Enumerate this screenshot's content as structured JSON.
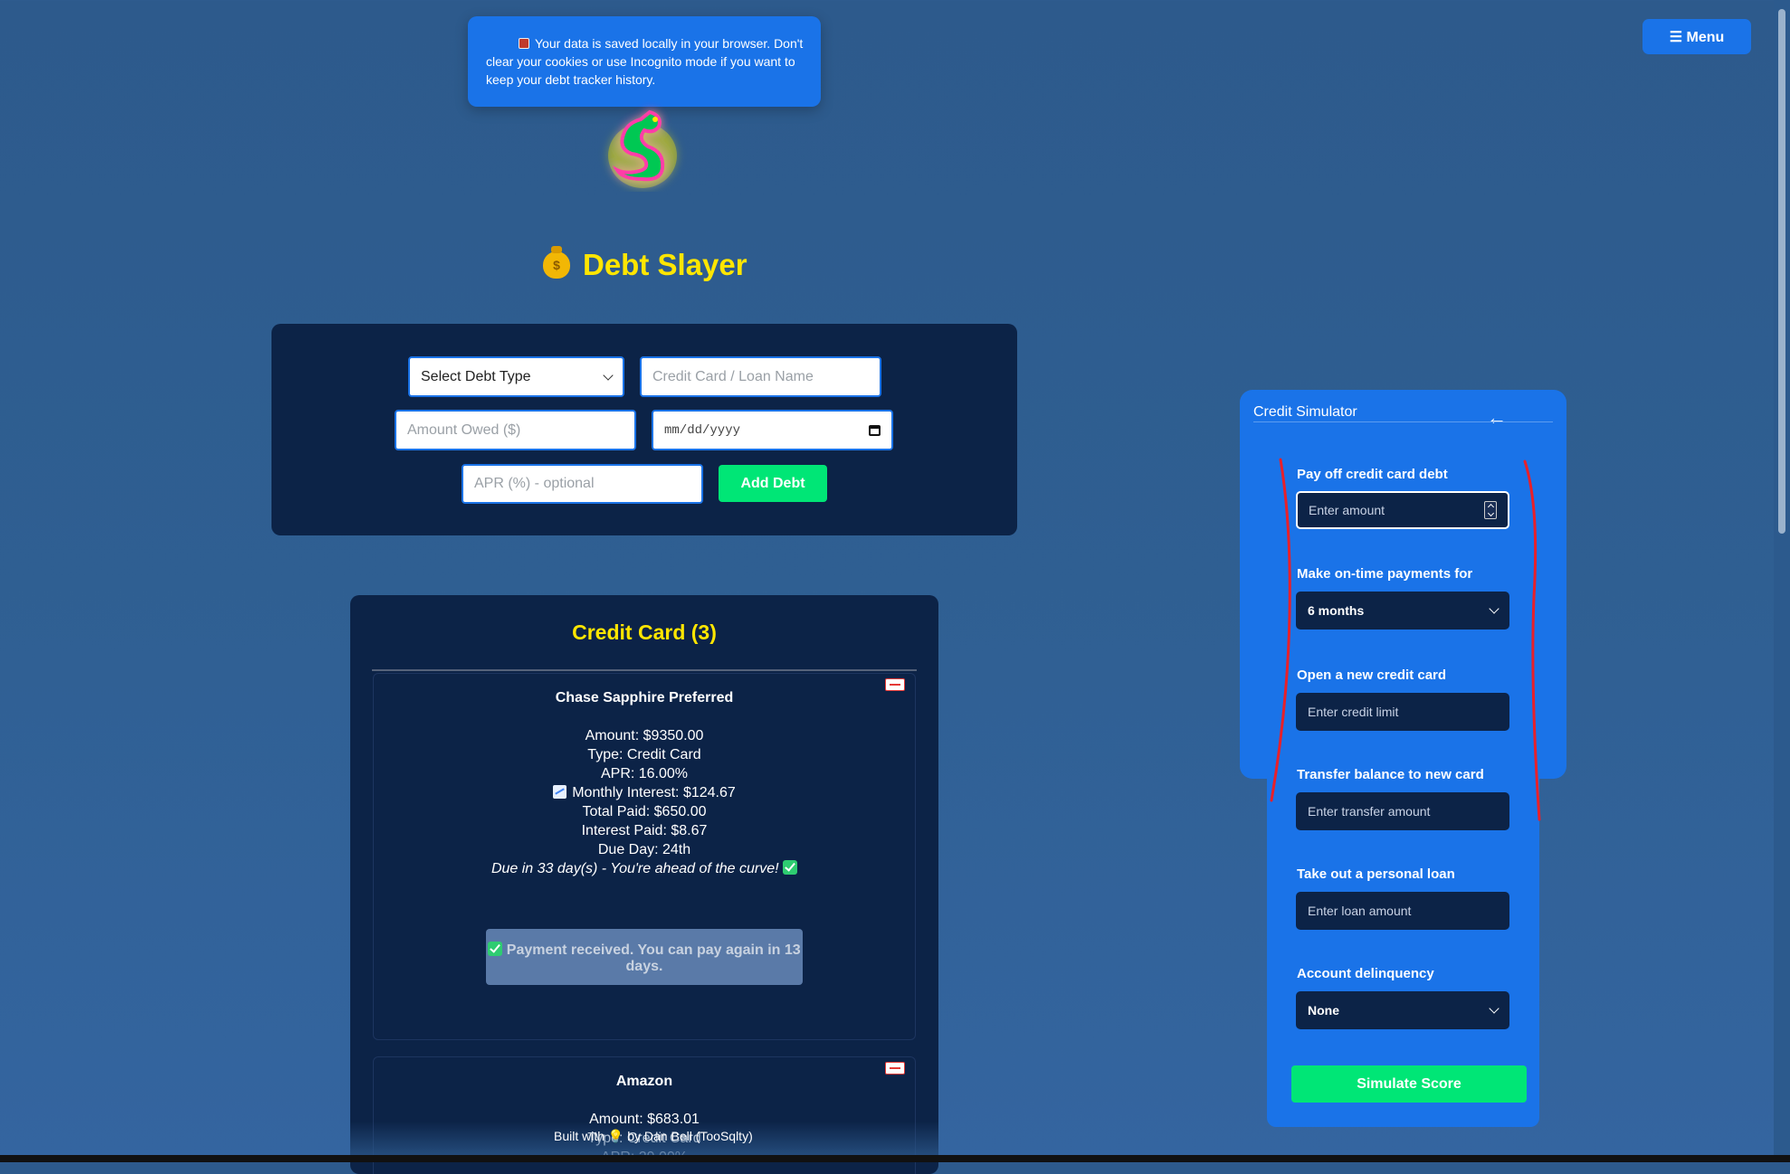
{
  "notice": {
    "text": "Your data is saved locally in your browser. Don't clear your cookies or use Incognito mode if you want to keep your debt tracker history."
  },
  "menu": {
    "label": "☰ Menu"
  },
  "app": {
    "title": "Debt Slayer",
    "bag_symbol": "$"
  },
  "form": {
    "debt_type": "Select Debt Type",
    "name_placeholder": "Credit Card / Loan Name",
    "amount_placeholder": "Amount Owed ($)",
    "date_placeholder": "mm/dd/yyyy",
    "apr_placeholder": "APR (%) - optional",
    "add_label": "Add Debt"
  },
  "list": {
    "heading": "Credit Card (3)",
    "cards": [
      {
        "name": "Chase Sapphire Preferred",
        "amount": "Amount: $9350.00",
        "type": "Type: Credit Card",
        "apr": "APR: 16.00%",
        "monthly_interest": "Monthly Interest: $124.67",
        "total_paid": "Total Paid: $650.00",
        "interest_paid": "Interest Paid: $8.67",
        "due_day": "Due Day: 24th",
        "due_note": "Due in 33 day(s) - You're ahead of the curve!",
        "payment_status": "Payment received. You can pay again in 13 days."
      },
      {
        "name": "Amazon",
        "amount": "Amount: $683.01",
        "type": "Type: Credit Card",
        "apr": "APR: 29.00%"
      }
    ]
  },
  "footer": {
    "text": "Built with 💡 by Dan Bell (TooSqlty)"
  },
  "simulator": {
    "title": "Credit Simulator",
    "back_arrow": "←",
    "payoff_label": "Pay off credit card debt",
    "payoff_placeholder": "Enter amount",
    "ontime_label": "Make on-time payments for",
    "ontime_value": "6 months",
    "newcard_label": "Open a new credit card",
    "newcard_placeholder": "Enter credit limit",
    "transfer_label": "Transfer balance to new card",
    "transfer_placeholder": "Enter transfer amount",
    "loan_label": "Take out a personal loan",
    "loan_placeholder": "Enter loan amount",
    "delinquency_label": "Account delinquency",
    "delinquency_value": "None",
    "simulate_label": "Simulate Score"
  },
  "colors": {
    "background": "#2f5f92",
    "panel": "#0c2347",
    "accent_blue": "#1a73e8",
    "accent_green": "#00e676",
    "title_yellow": "#ffe600",
    "annotation_red": "#e8202a"
  }
}
